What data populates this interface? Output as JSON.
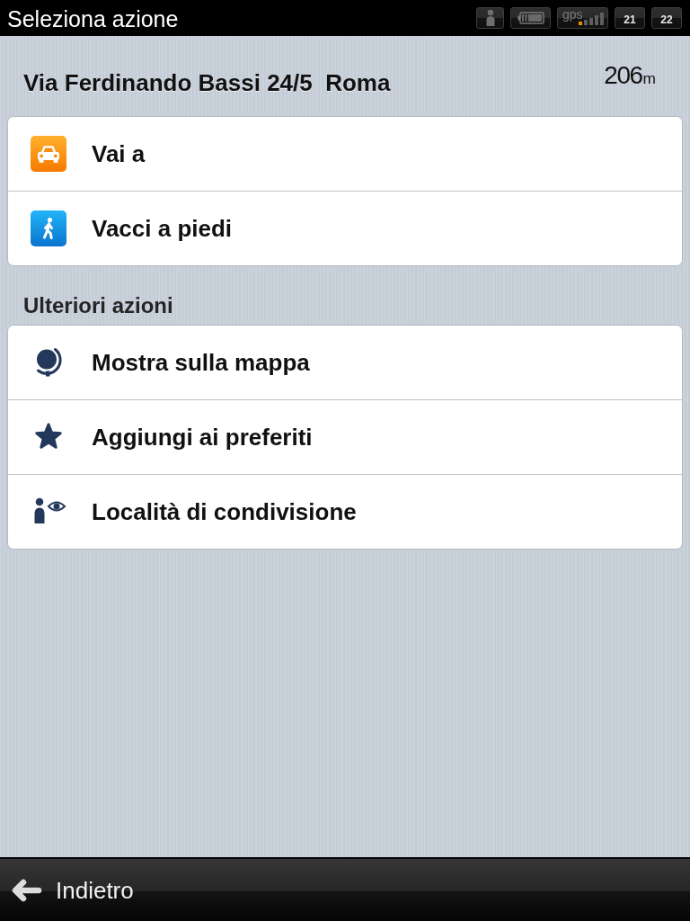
{
  "status_bar": {
    "title": "Seleziona azione",
    "indicators": [
      {
        "kind": "person"
      },
      {
        "kind": "battery"
      },
      {
        "kind": "gps",
        "label": "gps"
      },
      {
        "kind": "number",
        "label": "21"
      },
      {
        "kind": "number",
        "label": "22"
      }
    ]
  },
  "destination": {
    "address": "Via Ferdinando Bassi 24/5  Roma",
    "distance": "206$_{m}$"
  },
  "actions": [
    {
      "kind": "car",
      "label": "Vai a"
    },
    {
      "kind": "walk",
      "label": "Vacci a piedi"
    }
  ],
  "more_actions": {
    "title": "Ulteriori azioni",
    "items": [
      {
        "kind": "globe",
        "label": "Mostra sulla mappa"
      },
      {
        "kind": "star",
        "label": "Aggiungi ai preferiti"
      },
      {
        "kind": "share",
        "label": "Località di condivisione"
      }
    ]
  },
  "back_button": {
    "label": "Indietro"
  }
}
